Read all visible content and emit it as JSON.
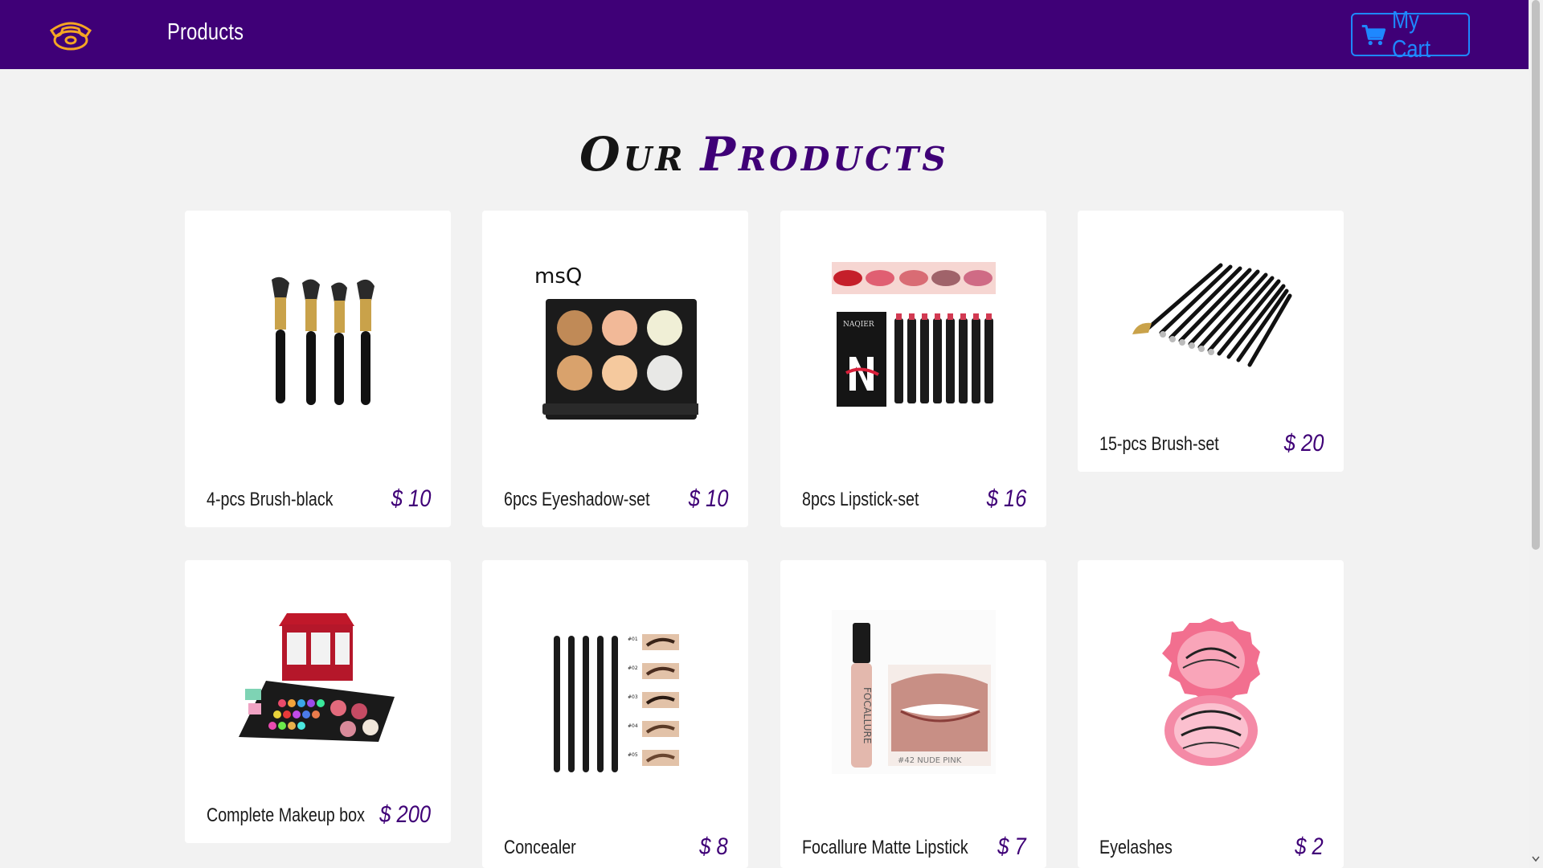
{
  "nav": {
    "logo_icon": "phone-icon",
    "products_link": "Products",
    "cart_label": "My Cart",
    "cart_icon": "cart-icon"
  },
  "heading": {
    "word1": "Our",
    "word2": "Products"
  },
  "colors": {
    "brand": "#3f0077",
    "accent": "#1e88ff",
    "logo": "#f5a623"
  },
  "products": [
    {
      "name": "4-pcs Brush-black",
      "price": "$ 10",
      "image": "makeup-brushes"
    },
    {
      "name": "6pcs Eyeshadow-set",
      "price": "$ 10",
      "image": "eyeshadow-palette",
      "brand_mark": "msQ"
    },
    {
      "name": "8pcs Lipstick-set",
      "price": "$ 16",
      "image": "lipstick-set",
      "brand_mark": "NAQIER"
    },
    {
      "name": "15-pcs Brush-set",
      "price": "$ 20",
      "image": "brush-set-fan"
    },
    {
      "name": "Complete Makeup box",
      "price": "$ 200",
      "image": "makeup-box"
    },
    {
      "name": "Concealer",
      "price": "$ 8",
      "image": "brow-pencils"
    },
    {
      "name": "Focallure Matte Lipstick",
      "price": "$ 7",
      "image": "liquid-lipstick",
      "shade_label": "#42   NUDE PINK"
    },
    {
      "name": "Eyelashes",
      "price": "$ 2",
      "image": "eyelashes-case"
    }
  ]
}
